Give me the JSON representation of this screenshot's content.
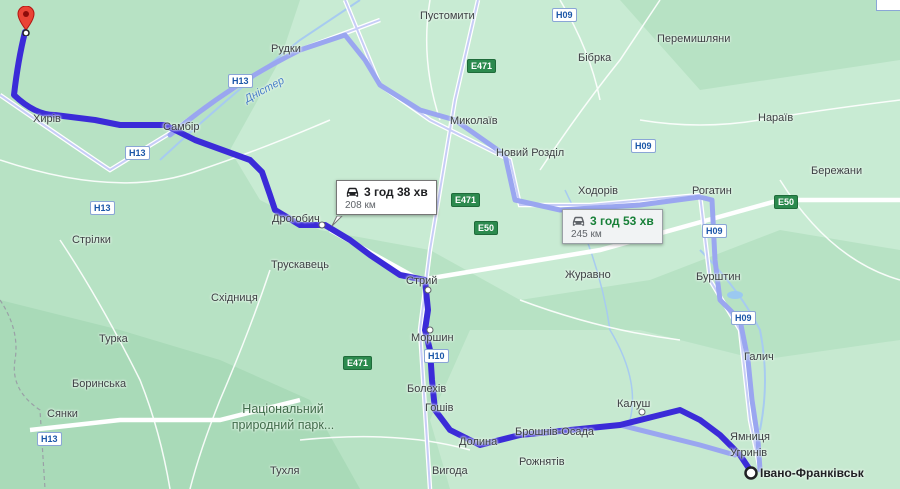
{
  "colors": {
    "route_primary": "#3b2bd8",
    "route_alt": "#9aa6f0",
    "water": "#9bc9f0",
    "land": "#b7e2c4",
    "destination_marker": "#202124",
    "origin_pin": "#ea4335"
  },
  "routes": [
    {
      "duration": "3 год 38 хв",
      "distance": "208 км",
      "selected": true
    },
    {
      "duration": "3 год 53 хв",
      "distance": "245 км",
      "selected": false
    }
  ],
  "destination": "Івано-Франківськ",
  "places": [
    "Пустомити",
    "Перемишляни",
    "Бібрка",
    "Рудки",
    "Дністер",
    "Миколаїв",
    "Нараїв",
    "Хирів",
    "Самбір",
    "Новий Розділ",
    "Бережани",
    "Ходорів",
    "Рогатин",
    "Дрогобич",
    "Стрілки",
    "Трускавець",
    "Стрий",
    "Журавно",
    "Бурштин",
    "Східниця",
    "Турка",
    "Моршин",
    "Боринська",
    "Галич",
    "Болехів",
    "Сянки",
    "Гошів",
    "Калуш",
    "Національний природний парк...",
    "Долина",
    "Брошнів-Осада",
    "Ямниця",
    "Угринів",
    "Рожнятів",
    "Тухля",
    "Вигода"
  ],
  "road_shields": [
    "H09",
    "E471",
    "H13",
    "H13",
    "H13",
    "H09",
    "E471",
    "E50",
    "E50",
    "H09",
    "H09",
    "E471",
    "H10",
    "H13"
  ],
  "icons": {
    "route_mode": "car-icon",
    "origin": "location-pin-icon",
    "destination": "destination-marker-icon"
  }
}
